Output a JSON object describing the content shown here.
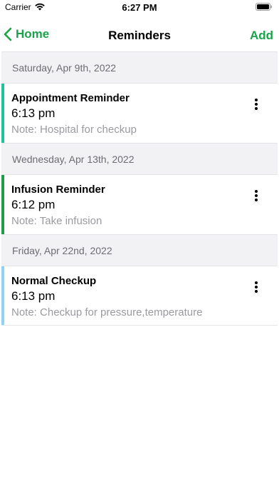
{
  "status_bar": {
    "carrier": "Carrier",
    "time": "6:27 PM"
  },
  "nav": {
    "back_label": "Home",
    "title": "Reminders",
    "add_label": "Add"
  },
  "colors": {
    "accent_green": "#1aa34a",
    "card_accent_1": "#21c29a",
    "card_accent_2": "#1e9c4a",
    "card_accent_3": "#8fd3f4"
  },
  "sections": [
    {
      "date": "Saturday, Apr 9th, 2022",
      "reminder": {
        "title": "Appointment Reminder",
        "time": "6:13 pm",
        "note": "Note: Hospital for checkup"
      }
    },
    {
      "date": "Wednesday, Apr 13th, 2022",
      "reminder": {
        "title": "Infusion Reminder",
        "time": "6:12 pm",
        "note": "Note: Take infusion"
      }
    },
    {
      "date": "Friday, Apr 22nd, 2022",
      "reminder": {
        "title": "Normal Checkup",
        "time": "6:13 pm",
        "note": "Note: Checkup for pressure,temperature"
      }
    }
  ]
}
